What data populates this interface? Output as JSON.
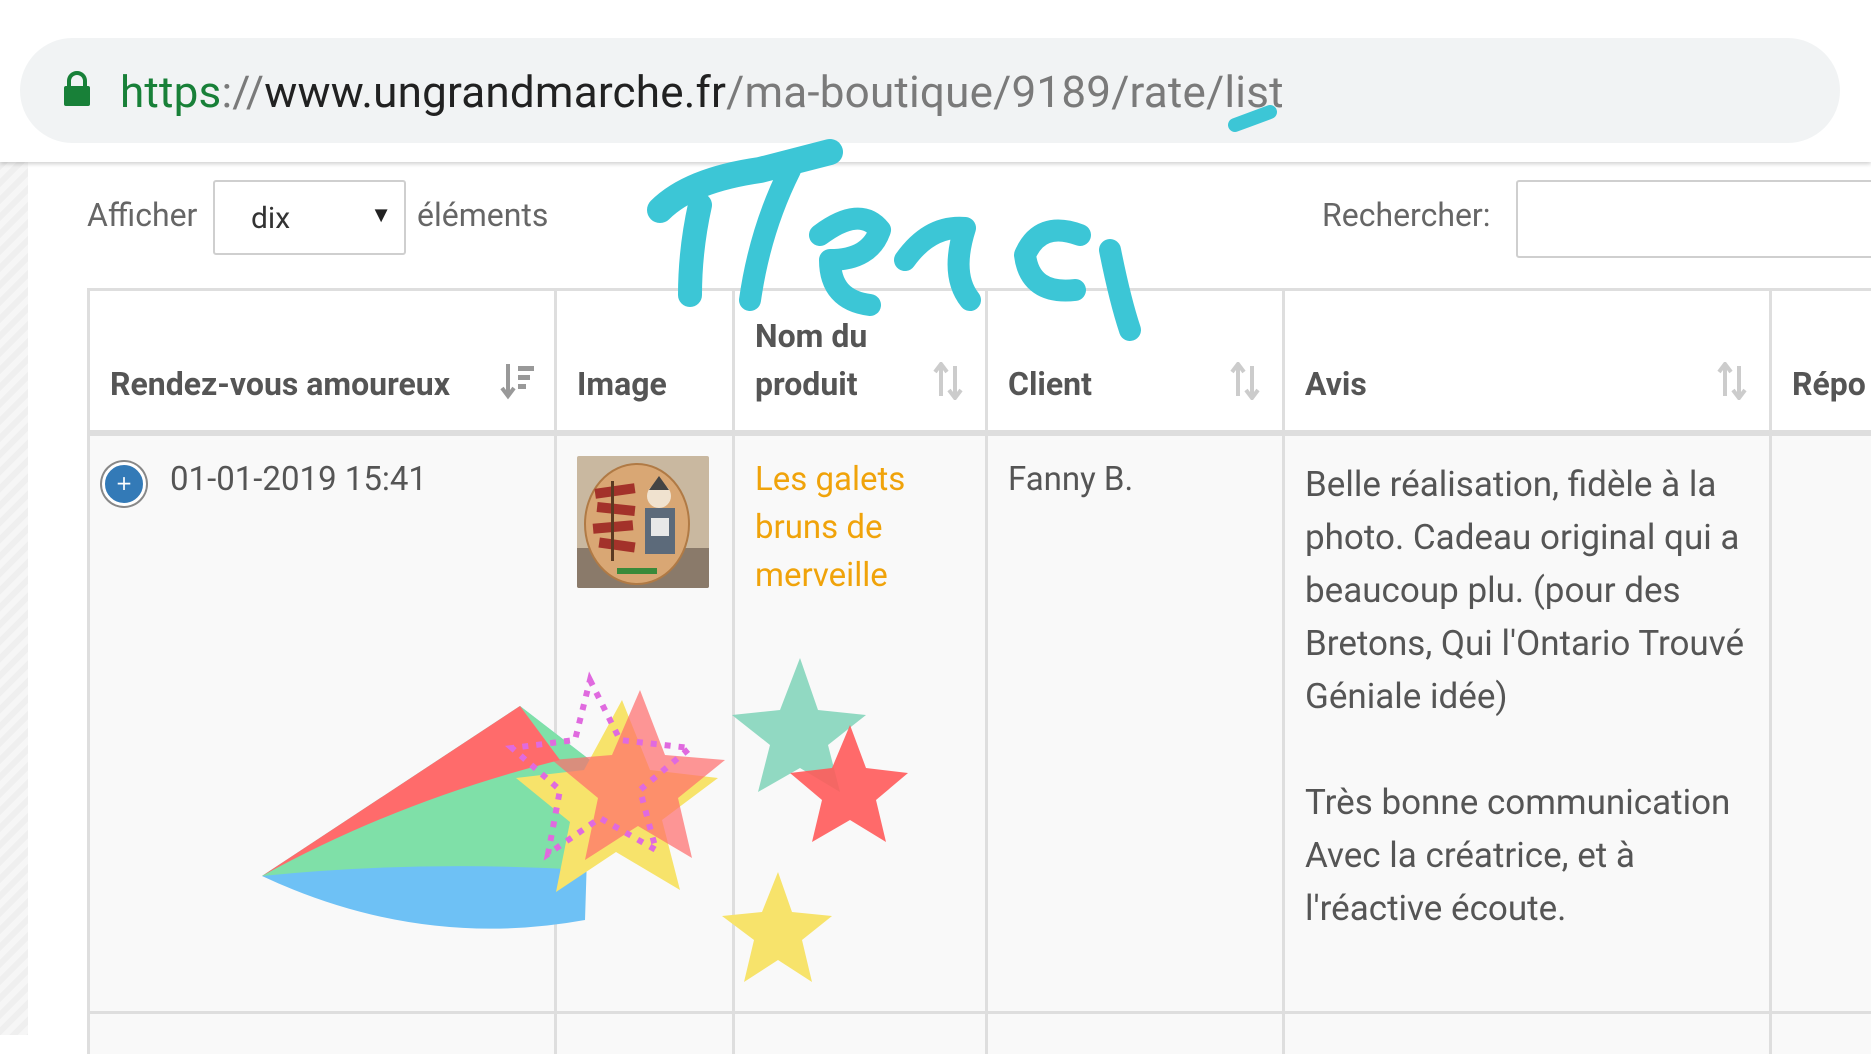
{
  "browser": {
    "url_scheme": "https",
    "url_sep": "://",
    "url_domain": "www.ungrandmarche.fr",
    "url_path": "/ma-boutique/9189/rate/list"
  },
  "controls": {
    "length_label": "Afficher",
    "length_value": "dix",
    "length_suffix": "éléments",
    "search_label": "Rechercher:",
    "search_value": ""
  },
  "table": {
    "columns": [
      {
        "label": "Rendez-vous amoureux",
        "sort": "sorted-desc"
      },
      {
        "label": "Image",
        "sort": "none"
      },
      {
        "label": "Nom du produit",
        "sort": "sortable"
      },
      {
        "label": "Client",
        "sort": "sortable"
      },
      {
        "label": "Avis",
        "sort": "sortable"
      },
      {
        "label": "Répo",
        "sort": "none"
      }
    ],
    "rows": [
      {
        "expand": "+",
        "date": "01-01-2019 15:41",
        "product": "Les galets bruns de merveille",
        "client": "Fanny B.",
        "review_p1": "Belle réalisation, fidèle à la photo. Cadeau original qui a beaucoup plu. (pour des Bretons, Qui l'Ontario Trouvé Géniale idée)",
        "review_p2": "Très bonne communication Avec la créatrice, et à l'réactive écoute.",
        "reply": ""
      }
    ]
  },
  "stickers": {
    "merci_color": "#3cc6d6",
    "star_colors": [
      "#ff6b6b",
      "#f7e36b",
      "#7fd4b8",
      "#e06adf",
      "#6ec1f5"
    ]
  }
}
